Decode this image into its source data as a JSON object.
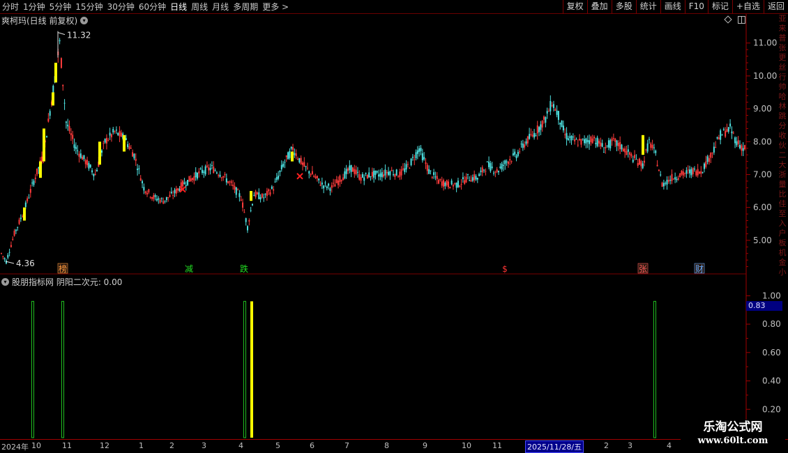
{
  "toolbar": {
    "periods": [
      "分时",
      "1分钟",
      "5分钟",
      "15分钟",
      "30分钟",
      "60分钟",
      "日线",
      "周线",
      "月线",
      "多周期",
      "更多 >"
    ],
    "active_period": 6,
    "buttons": [
      "复权",
      "叠加",
      "多股",
      "统计",
      "画线",
      "F10",
      "标记",
      "+自选",
      "返回"
    ]
  },
  "main_panel": {
    "title": "爽柯玛(日线 前复权)",
    "high_label": "11.32",
    "low_label": "4.36",
    "events": [
      {
        "label": "榜",
        "color": "#ff9a3c",
        "box": true
      },
      {
        "label": "减",
        "color": "#22dd22",
        "box": false
      },
      {
        "label": "跌",
        "color": "#22dd22",
        "box": false
      },
      {
        "label": "$",
        "color": "#ff3333",
        "box": false
      },
      {
        "label": "张",
        "color": "#ff5a5a",
        "box": true
      },
      {
        "label": "财",
        "color": "#66aaff",
        "box": true
      }
    ]
  },
  "sub_panel": {
    "title": "股朋指标网 阴阳二次元: 0.00",
    "current_value": "0.83"
  },
  "right_strip": [
    "亚",
    "来",
    "普",
    "张",
    "更",
    "丝",
    "行",
    "帅",
    "哈",
    "林",
    "跳",
    "分",
    "收",
    "伙",
    "二",
    "大",
    "浙",
    "量",
    "比",
    "佳",
    "至",
    "入",
    "户",
    "板",
    "机",
    "金",
    "小"
  ],
  "date_axis": {
    "labels": [
      "2024年",
      "10",
      "11",
      "12",
      "1",
      "2",
      "3",
      "4",
      "5",
      "6",
      "7",
      "8",
      "9",
      "10",
      "11",
      "2",
      "3",
      "4"
    ],
    "cursor_date": "2025/11/28/五"
  },
  "watermark": {
    "name": "乐淘公式网",
    "url": "www.60lt.com"
  },
  "chart_data": [
    {
      "type": "candlestick",
      "title": "爽柯玛(日线 前复权)",
      "y_axis": {
        "ticks": [
          "11.00",
          "10.00",
          "9.00",
          "8.00",
          "7.00",
          "6.00",
          "5.00"
        ],
        "ylim": [
          4.0,
          11.8
        ]
      },
      "high": 11.32,
      "low": 4.36,
      "price_anchors": [
        [
          0,
          4.6
        ],
        [
          3,
          4.36
        ],
        [
          8,
          5.2
        ],
        [
          14,
          5.9
        ],
        [
          20,
          6.8
        ],
        [
          26,
          7.6
        ],
        [
          32,
          9.6
        ],
        [
          36,
          11.0
        ],
        [
          40,
          8.6
        ],
        [
          46,
          7.8
        ],
        [
          52,
          7.4
        ],
        [
          58,
          7.0
        ],
        [
          64,
          8.0
        ],
        [
          70,
          8.3
        ],
        [
          76,
          8.1
        ],
        [
          82,
          7.6
        ],
        [
          88,
          6.6
        ],
        [
          94,
          6.3
        ],
        [
          100,
          6.2
        ],
        [
          106,
          6.4
        ],
        [
          112,
          6.7
        ],
        [
          118,
          6.9
        ],
        [
          124,
          7.1
        ],
        [
          130,
          7.2
        ],
        [
          136,
          7.0
        ],
        [
          142,
          6.7
        ],
        [
          148,
          6.3
        ],
        [
          152,
          5.4
        ],
        [
          156,
          6.4
        ],
        [
          162,
          6.3
        ],
        [
          168,
          6.6
        ],
        [
          174,
          7.3
        ],
        [
          180,
          7.8
        ],
        [
          186,
          7.3
        ],
        [
          192,
          7.0
        ],
        [
          198,
          6.7
        ],
        [
          204,
          6.6
        ],
        [
          210,
          6.9
        ],
        [
          216,
          7.2
        ],
        [
          222,
          6.9
        ],
        [
          228,
          7.0
        ],
        [
          234,
          7.0
        ],
        [
          240,
          7.1
        ],
        [
          246,
          7.0
        ],
        [
          252,
          7.3
        ],
        [
          258,
          7.8
        ],
        [
          264,
          7.1
        ],
        [
          270,
          6.8
        ],
        [
          276,
          6.7
        ],
        [
          282,
          6.7
        ],
        [
          288,
          6.9
        ],
        [
          294,
          6.9
        ],
        [
          300,
          7.3
        ],
        [
          306,
          7.1
        ],
        [
          312,
          7.4
        ],
        [
          318,
          7.6
        ],
        [
          324,
          8.0
        ],
        [
          330,
          8.3
        ],
        [
          336,
          8.7
        ],
        [
          340,
          9.2
        ],
        [
          344,
          8.8
        ],
        [
          348,
          8.2
        ],
        [
          354,
          8.0
        ],
        [
          360,
          8.0
        ],
        [
          366,
          8.1
        ],
        [
          372,
          7.8
        ],
        [
          378,
          8.0
        ],
        [
          384,
          7.8
        ],
        [
          390,
          7.5
        ],
        [
          396,
          7.3
        ],
        [
          400,
          8.0
        ],
        [
          404,
          7.6
        ],
        [
          408,
          6.7
        ],
        [
          414,
          6.9
        ],
        [
          420,
          7.0
        ],
        [
          426,
          7.1
        ],
        [
          432,
          7.1
        ],
        [
          438,
          7.6
        ],
        [
          444,
          8.2
        ],
        [
          450,
          8.4
        ],
        [
          454,
          8.0
        ],
        [
          458,
          7.8
        ]
      ],
      "flat_markers": [
        [
          260,
          1
        ],
        [
          384,
          0
        ],
        [
          524,
          1
        ],
        [
          710,
          0
        ],
        [
          918,
          1
        ],
        [
          932,
          0
        ]
      ],
      "yellow_bars": [
        {
          "x": 35,
          "open": 5.6,
          "close": 6.0
        },
        {
          "x": 58,
          "open": 6.9,
          "close": 7.4
        },
        {
          "x": 63,
          "open": 7.4,
          "close": 8.4
        },
        {
          "x": 76,
          "open": 9.1,
          "close": 9.5
        },
        {
          "x": 80,
          "open": 9.8,
          "close": 10.4
        },
        {
          "x": 143,
          "open": 7.3,
          "close": 8.0
        },
        {
          "x": 178,
          "open": 7.7,
          "close": 8.2
        },
        {
          "x": 360,
          "open": 6.2,
          "close": 6.5
        },
        {
          "x": 419,
          "open": 7.4,
          "close": 7.7
        },
        {
          "x": 922,
          "open": 7.6,
          "close": 8.2
        }
      ],
      "cross_marks": [
        {
          "x": 262,
          "price": 6.55
        },
        {
          "x": 430,
          "price": 6.95
        }
      ]
    },
    {
      "type": "bar",
      "title": "股朋指标网 阴阳二次元: 0.00",
      "y_axis": {
        "ticks": [
          "1.00",
          "0.80",
          "0.60",
          "0.40",
          "0.20"
        ],
        "ylim": [
          0,
          1.1
        ]
      },
      "bars": [
        {
          "x": 47,
          "value": 1.0,
          "color": "#20c020",
          "style": "outline"
        },
        {
          "x": 90,
          "value": 1.0,
          "color": "#20c020",
          "style": "outline"
        },
        {
          "x": 351,
          "value": 1.0,
          "color": "#20c020",
          "style": "outline"
        },
        {
          "x": 361,
          "value": 1.0,
          "color": "#ffff00",
          "style": "solid"
        },
        {
          "x": 939,
          "value": 1.0,
          "color": "#20c020",
          "style": "outline"
        }
      ],
      "current_value": 0.83
    }
  ]
}
